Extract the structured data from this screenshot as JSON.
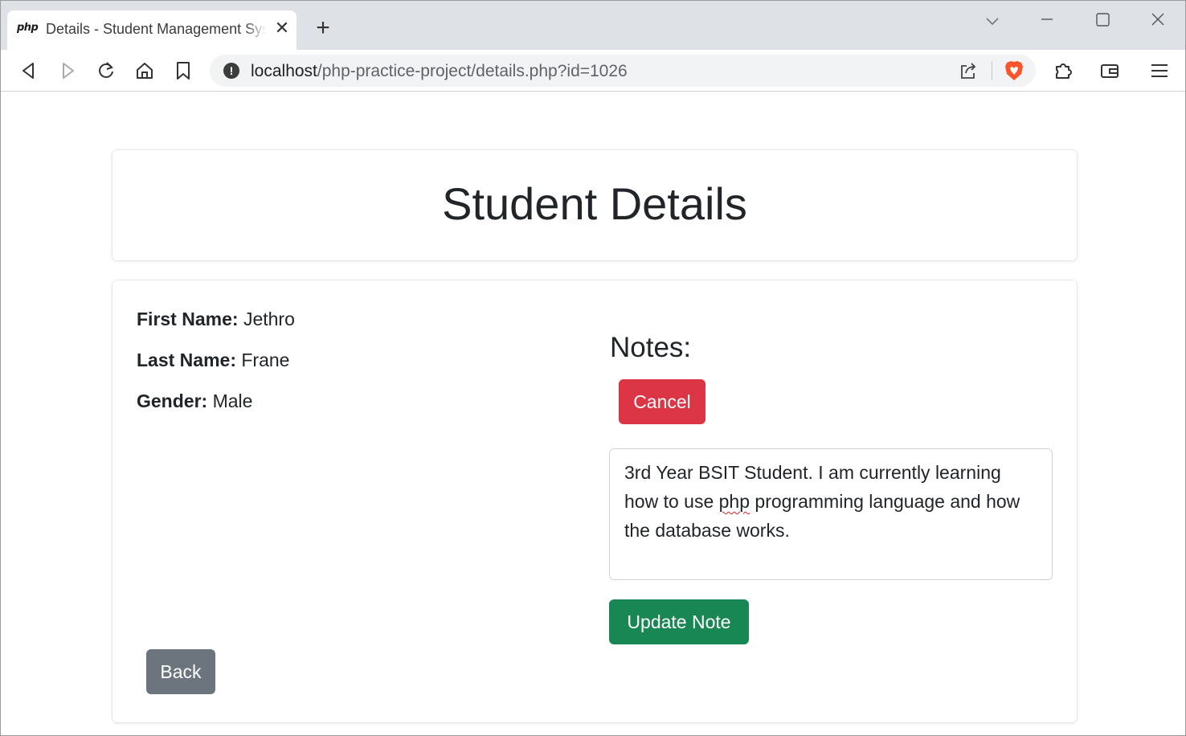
{
  "browser": {
    "tab": {
      "favicon_text": "php",
      "title": "Details - Student Management System",
      "close_glyph": "✕"
    },
    "new_tab_glyph": "+",
    "url": {
      "host": "localhost",
      "path": "/php-practice-project/details.php?id=1026"
    },
    "info_glyph": "!",
    "icons": [
      "back-icon",
      "forward-icon",
      "reload-icon",
      "home-icon",
      "bookmark-icon",
      "info-icon",
      "share-icon",
      "brave-shield-icon",
      "extensions-icon",
      "wallet-icon",
      "menu-icon",
      "tab-search-icon",
      "minimize-icon",
      "maximize-icon",
      "close-window-icon"
    ]
  },
  "page": {
    "title": "Student Details",
    "student": {
      "first_name_label": "First Name:",
      "first_name": "Jethro",
      "last_name_label": "Last Name:",
      "last_name": "Frane",
      "gender_label": "Gender:",
      "gender": "Male"
    },
    "notes": {
      "heading": "Notes:",
      "cancel_label": "Cancel",
      "text_part1": "3rd Year BSIT Student. I am currently learning how to use ",
      "text_misspelled": "php",
      "text_part2": " programming language and how the database works.",
      "update_label": "Update Note"
    },
    "back_label": "Back"
  },
  "colors": {
    "danger": "#dc3545",
    "success": "#198754",
    "secondary": "#6c757d",
    "text": "#212529",
    "tabstrip": "#dee1e6",
    "brave_orange": "#fb542b"
  }
}
